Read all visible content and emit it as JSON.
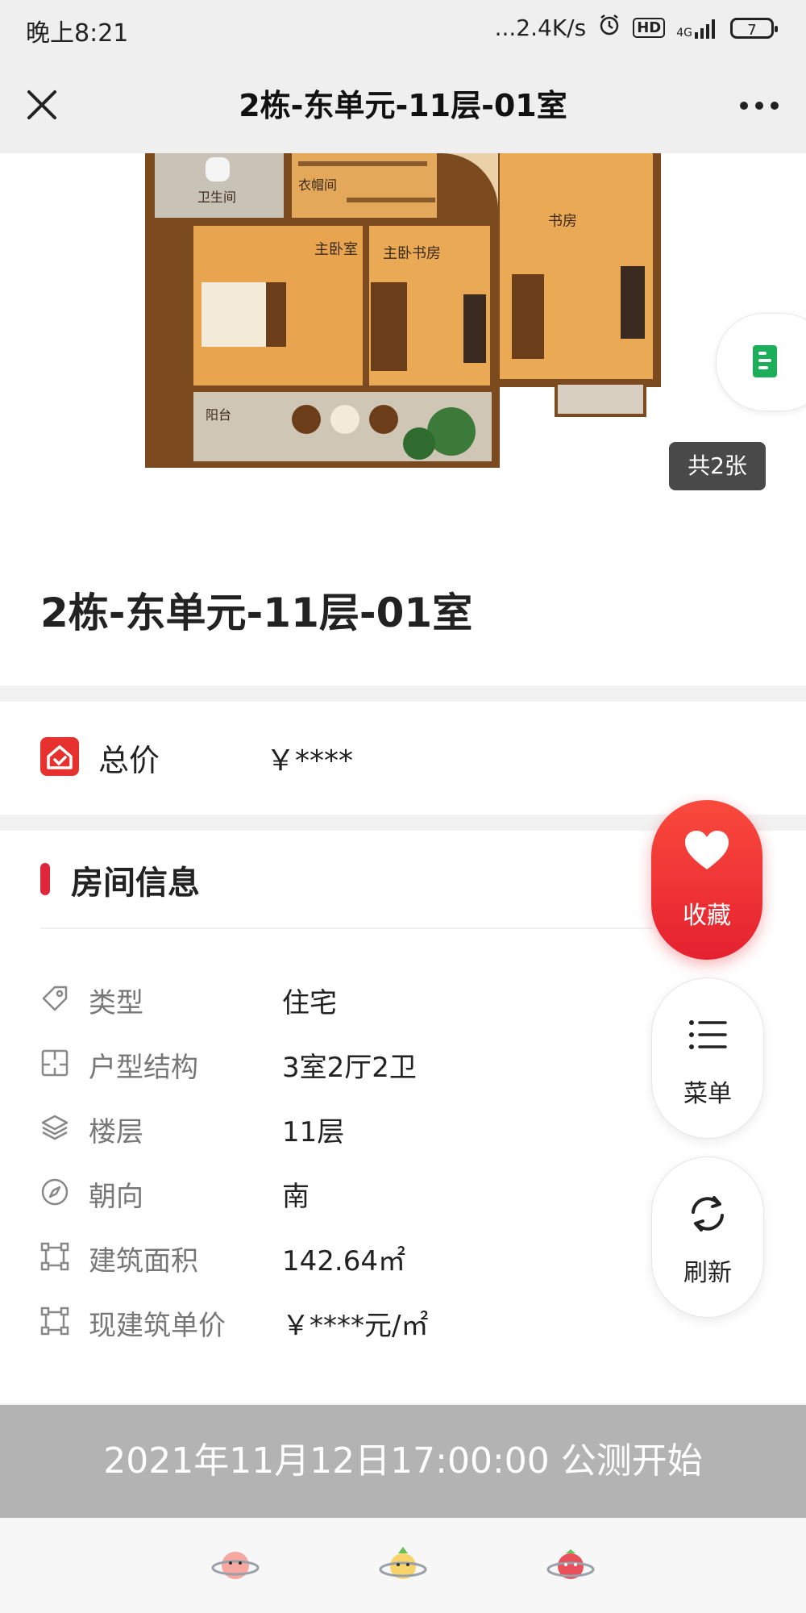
{
  "status_bar": {
    "time": "晚上8:21",
    "network_speed": "...2.4K/s",
    "alarm_icon": "alarm-icon",
    "hd_badge": "HD",
    "signal_label": "4G",
    "battery_level": "7"
  },
  "title_bar": {
    "title": "2栋-东单元-11层-01室",
    "close_icon": "close-icon",
    "more_icon": "more-dots-icon"
  },
  "gallery": {
    "count_label": "共2张",
    "plan_labels": {
      "toilet": "卫生间",
      "closet": "衣帽间",
      "master_bedroom": "主卧室",
      "master_study": "主卧书房",
      "study": "书房",
      "balcony": "阳台"
    }
  },
  "house": {
    "name": "2栋-东单元-11层-01室"
  },
  "price": {
    "label": "总价",
    "value": "￥****"
  },
  "room_info": {
    "title": "房间信息",
    "rows": [
      {
        "icon": "tag-icon",
        "label": "类型",
        "value": "住宅"
      },
      {
        "icon": "floorplan-icon",
        "label": "户型结构",
        "value": "3室2厅2卫"
      },
      {
        "icon": "layers-icon",
        "label": "楼层",
        "value": "11层"
      },
      {
        "icon": "compass-icon",
        "label": "朝向",
        "value": "南"
      },
      {
        "icon": "area-icon",
        "label": "建筑面积",
        "value": "142.64㎡"
      },
      {
        "icon": "area-icon",
        "label": "现建筑单价",
        "value": "￥****元/㎡"
      }
    ]
  },
  "float_buttons": {
    "favorite": "收藏",
    "menu": "菜单",
    "refresh": "刷新"
  },
  "banner": {
    "text": "2021年11月12日17:00:00 公测开始"
  },
  "colors": {
    "accent": "#e52130",
    "banner_bg": "#b3b3b3",
    "doc_green": "#1cae5b"
  }
}
